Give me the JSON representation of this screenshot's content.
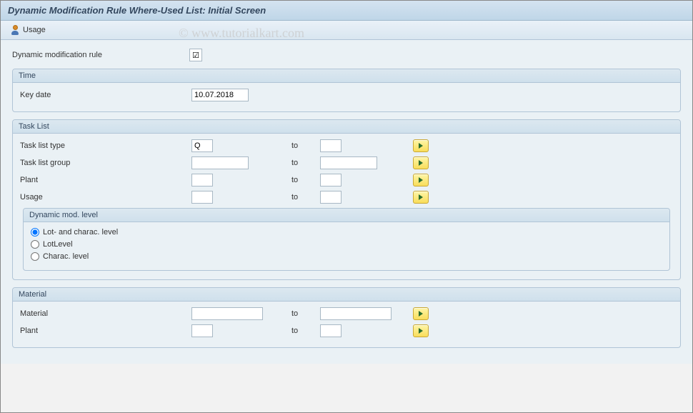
{
  "title": "Dynamic Modification Rule Where-Used List: Initial Screen",
  "watermark": "© www.tutorialkart.com",
  "toolbar": {
    "usage_label": "Usage"
  },
  "main_field": {
    "label": "Dynamic modification rule",
    "value": "☑"
  },
  "time_group": {
    "title": "Time",
    "key_date_label": "Key date",
    "key_date_value": "10.07.2018"
  },
  "tasklist_group": {
    "title": "Task List",
    "rows": [
      {
        "label": "Task list type",
        "from": "Q",
        "to": "",
        "from_width": "small",
        "to_width": "small"
      },
      {
        "label": "Task list group",
        "from": "",
        "to": "",
        "from_width": "med",
        "to_width": "med"
      },
      {
        "label": "Plant",
        "from": "",
        "to": "",
        "from_width": "small",
        "to_width": "small"
      },
      {
        "label": "Usage",
        "from": "",
        "to": "",
        "from_width": "small",
        "to_width": "small"
      }
    ],
    "dyn_level": {
      "title": "Dynamic mod. level",
      "options": [
        {
          "label": "Lot- and charac. level",
          "selected": true
        },
        {
          "label": "LotLevel",
          "selected": false
        },
        {
          "label": "Charac. level",
          "selected": false
        }
      ]
    }
  },
  "material_group": {
    "title": "Material",
    "rows": [
      {
        "label": "Material",
        "from": "",
        "to": "",
        "from_width": "wide",
        "to_width": "wide"
      },
      {
        "label": "Plant",
        "from": "",
        "to": "",
        "from_width": "small",
        "to_width": "small"
      }
    ]
  },
  "common": {
    "to_label": "to"
  }
}
